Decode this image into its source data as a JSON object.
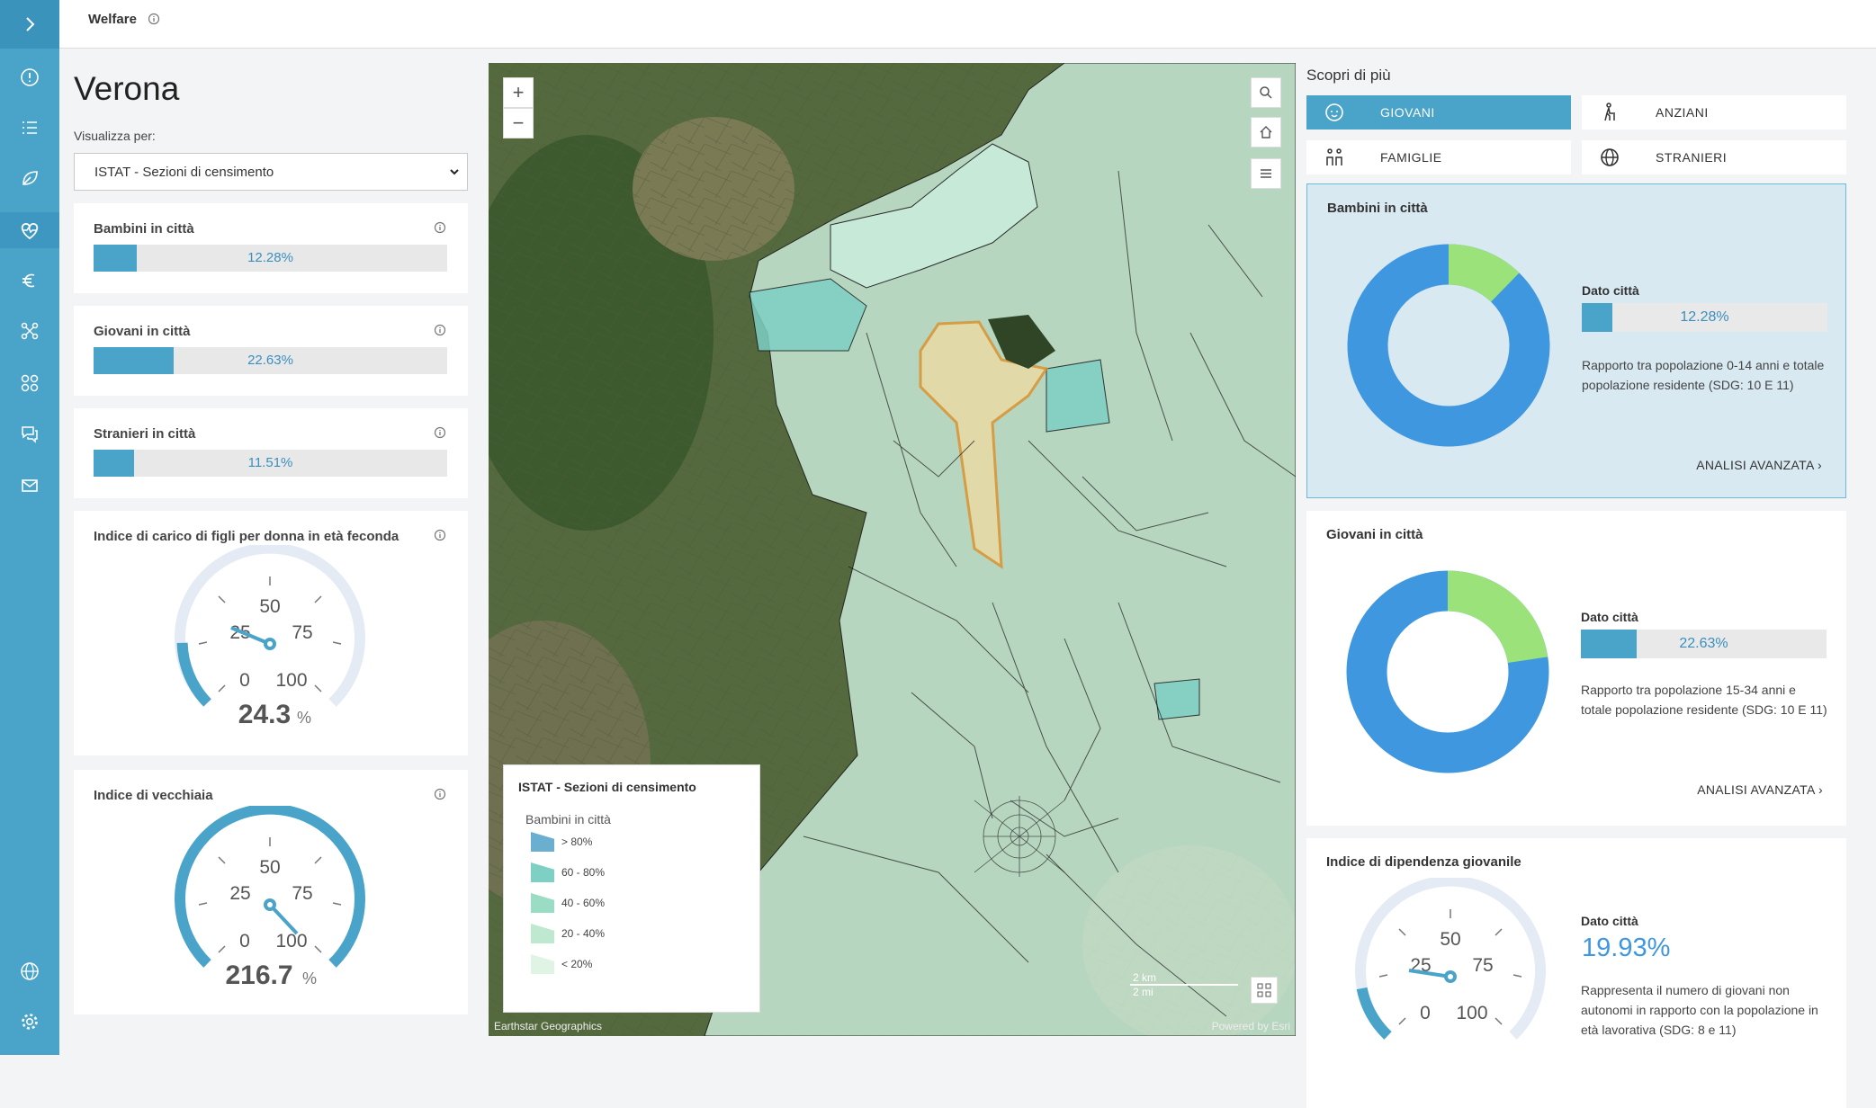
{
  "app": {
    "title": "Welfare"
  },
  "left": {
    "city": "Verona",
    "view_label": "Visualizza per:",
    "view_select": "ISTAT - Sezioni di censimento",
    "bambini": {
      "title": "Bambini in città",
      "value": "12.28%",
      "pct": 12.28
    },
    "giovani": {
      "title": "Giovani in città",
      "value": "22.63%",
      "pct": 22.63
    },
    "stranieri": {
      "title": "Stranieri in città",
      "value": "11.51%",
      "pct": 11.51
    },
    "indice_figli": {
      "title": "Indice di carico di figli per donna in età feconda",
      "value": "24.3",
      "unit": "%",
      "ticks": [
        "0",
        "25",
        "50",
        "75",
        "100"
      ]
    },
    "indice_vecchiaia": {
      "title": "Indice di vecchiaia",
      "value": "216.7",
      "unit": "%",
      "ticks": [
        "0",
        "25",
        "50",
        "75",
        "100"
      ]
    }
  },
  "map": {
    "legend_title": "ISTAT - Sezioni di censimento",
    "legend_sub": "Bambini in città",
    "legend_items": [
      "> 80%",
      "60 - 80%",
      "40 - 60%",
      "20 - 40%",
      "< 20%"
    ],
    "legend_colors": [
      "#6aaed0",
      "#7ed0c4",
      "#9adcc4",
      "#bfe8d0",
      "#e0f4e6"
    ],
    "attribution_left": "Earthstar Geographics",
    "attribution_right": "Powered by Esri",
    "scale_km": "2 km",
    "scale_mi": "2 mi",
    "zoom_in": "+",
    "zoom_out": "−"
  },
  "right": {
    "title": "Scopri di più",
    "tabs": [
      {
        "label": "GIOVANI",
        "icon": "baby-icon",
        "active": true
      },
      {
        "label": "ANZIANI",
        "icon": "elderly-icon",
        "active": false
      },
      {
        "label": "FAMIGLIE",
        "icon": "family-icon",
        "active": false
      },
      {
        "label": "STRANIERI",
        "icon": "globe-icon",
        "active": false
      }
    ],
    "bambini": {
      "title": "Bambini in città",
      "dato_label": "Dato città",
      "value": "12.28%",
      "pct": 12.28,
      "desc": "Rapporto tra popolazione 0-14 anni e totale popolazione residente (SDG: 10 E 11)",
      "link": "ANALISI AVANZATA"
    },
    "giovani": {
      "title": "Giovani in città",
      "dato_label": "Dato città",
      "value": "22.63%",
      "pct": 22.63,
      "desc": "Rapporto tra popolazione 15-34 anni e totale popolazione residente (SDG: 10 E 11)",
      "link": "ANALISI AVANZATA"
    },
    "dipendenza": {
      "title": "Indice di dipendenza giovanile",
      "dato_label": "Dato città",
      "value": "19.93%",
      "desc": "Rappresenta il numero di giovani non autonomi in rapporto con la popolazione in età lavorativa (SDG: 8 e 11)",
      "ticks": [
        "0",
        "25",
        "50",
        "75",
        "100"
      ]
    }
  },
  "colors": {
    "accent": "#4aa3c9",
    "donut_main": "#3f97e0",
    "donut_part": "#9be27a"
  }
}
